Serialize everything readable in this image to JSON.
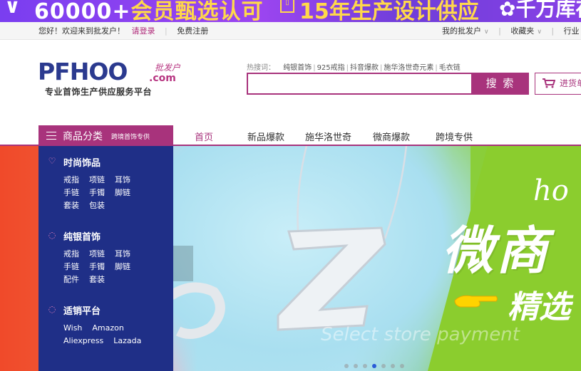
{
  "promo": {
    "text_a": "60000+",
    "text_b": "会员甄选认可",
    "badge": "15",
    "text_c": "15年生产设计供应",
    "text_d": "千万库存"
  },
  "userbar": {
    "greeting": "您好！欢迎来到批发户！",
    "login": "请登录",
    "register": "免费注册",
    "my_account": "我的批发户",
    "favorites": "收藏夹",
    "industry": "行业"
  },
  "logo": {
    "brand": "PFHOO",
    "brand_cn": "批发户",
    "domain": ".com",
    "slogan": "专业首饰生产供应服务平台"
  },
  "search": {
    "hot_label": "热搜词：",
    "hot_words": [
      "纯银首饰",
      "925戒指",
      "抖音爆款",
      "施华洛世奇元素",
      "毛衣链"
    ],
    "placeholder": "",
    "button": "搜 索",
    "cart": "进货单"
  },
  "nav": {
    "category_title": "商品分类",
    "category_sub": "跨境首饰专供",
    "items": [
      "首页",
      "新品爆款",
      "施华洛世奇",
      "微商爆款",
      "跨境专供"
    ],
    "active_index": 0
  },
  "categories": [
    {
      "title": "时尚饰品",
      "icon": "necklace-icon",
      "rows": [
        [
          "戒指",
          "项链",
          "耳饰"
        ],
        [
          "手链",
          "手镯",
          "脚链"
        ],
        [
          "套装",
          "包装"
        ]
      ]
    },
    {
      "title": "纯银首饰",
      "icon": "ring-icon",
      "rows": [
        [
          "戒指",
          "项链",
          "耳饰"
        ],
        [
          "手链",
          "手镯",
          "脚链"
        ],
        [
          "配件",
          "套装"
        ]
      ]
    },
    {
      "title": "适销平台",
      "icon": "ring-icon",
      "rows": [
        [
          "Wish",
          "Amazon"
        ],
        [
          "Aliexpress",
          "Lazada"
        ]
      ]
    }
  ],
  "banner": {
    "headline": "微商",
    "subline": "精选",
    "script": "ho",
    "ghost_text": "Select store payment",
    "slide_count": 7,
    "active_slide": 3
  },
  "colors": {
    "brand": "#a8337c",
    "panel": "#1f2f87",
    "logo_blue": "#2b3a8f"
  }
}
